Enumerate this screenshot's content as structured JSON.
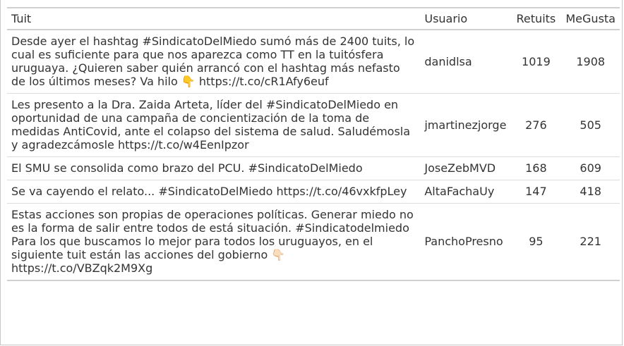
{
  "table": {
    "headers": {
      "tweet": "Tuit",
      "user": "Usuario",
      "retweets": "Retuits",
      "likes": "MeGusta"
    },
    "rows": [
      {
        "text": "Desde ayer el hashtag #SindicatoDelMiedo sumó más de 2400 tuits, lo cual es suficiente para que nos aparezca como TT en la tuitósfera uruguaya. ¿Quieren saber quién arrancó con el hashtag más nefasto de los últimos meses? Va hilo 👇 https://t.co/cR1Afy6euf",
        "user": "danidlsa",
        "retweets": "1019",
        "likes": "1908"
      },
      {
        "text": "Les presento a la Dra. Zaida Arteta, líder del #SindicatoDelMiedo en oportunidad de una campaña de concientización de la toma de medidas AntiCovid, ante el colapso del sistema de salud. Saludémosla y agradezcámosle https://t.co/w4EenIpzor",
        "user": "jmartinezjorge",
        "retweets": "276",
        "likes": "505"
      },
      {
        "text": "El SMU se consolida como brazo del PCU. #SindicatoDelMiedo",
        "user": "JoseZebMVD",
        "retweets": "168",
        "likes": "609"
      },
      {
        "text": "Se va cayendo el relato... #SindicatoDelMiedo https://t.co/46vxkfpLey",
        "user": "AltaFachaUy",
        "retweets": "147",
        "likes": "418"
      },
      {
        "text": "Estas acciones son propias de operaciones políticas. Generar miedo no es la forma de salir entre todos de está situación. #Sindicatodelmiedo Para los que buscamos lo mejor para todos los uruguayos, en el siguiente tuit están las acciones del gobierno 👇🏻 https://t.co/VBZqk2M9Xg",
        "user": "PanchoPresno",
        "retweets": "95",
        "likes": "221"
      }
    ]
  }
}
